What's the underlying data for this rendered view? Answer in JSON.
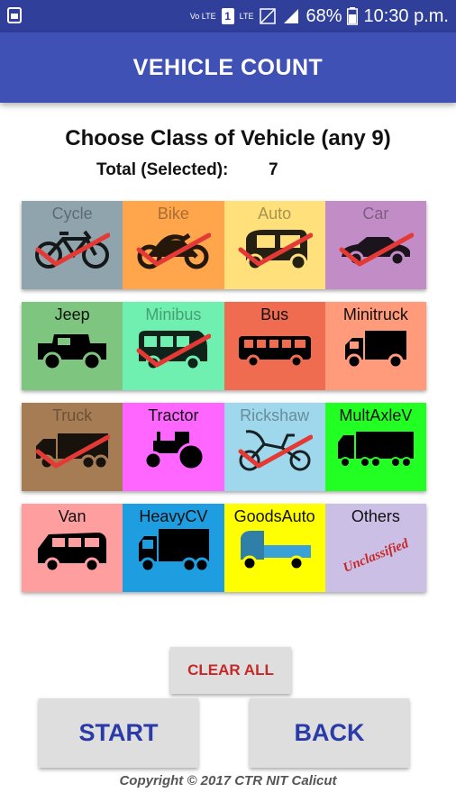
{
  "status_bar": {
    "volte": "Vo LTE",
    "sim": "1",
    "lte": "LTE",
    "battery": "68%",
    "time": "10:30 p.m."
  },
  "app_bar": {
    "title": "VEHICLE COUNT"
  },
  "heading": "Choose Class of Vehicle (any 9)",
  "total": {
    "label": "Total (Selected):",
    "value": "7"
  },
  "tiles": [
    {
      "label": "Cycle",
      "color": "#90a4ae",
      "selected": true,
      "icon": "bicycle-icon"
    },
    {
      "label": "Bike",
      "color": "#ffa64d",
      "selected": true,
      "icon": "motorbike-icon"
    },
    {
      "label": "Auto",
      "color": "#ffe07a",
      "selected": true,
      "icon": "autorickshaw-icon"
    },
    {
      "label": "Car",
      "color": "#c28dc7",
      "selected": true,
      "icon": "car-icon"
    },
    {
      "label": "Jeep",
      "color": "#7ec57f",
      "selected": false,
      "icon": "jeep-icon"
    },
    {
      "label": "Minibus",
      "color": "#6ff0b0",
      "selected": true,
      "icon": "minibus-icon"
    },
    {
      "label": "Bus",
      "color": "#ef6c50",
      "selected": false,
      "icon": "bus-icon"
    },
    {
      "label": "Minitruck",
      "color": "#ff9b7a",
      "selected": false,
      "icon": "minitruck-icon"
    },
    {
      "label": "Truck",
      "color": "#a67c55",
      "selected": true,
      "icon": "truck-icon"
    },
    {
      "label": "Tractor",
      "color": "#ff66ff",
      "selected": false,
      "icon": "tractor-icon"
    },
    {
      "label": "Rickshaw",
      "color": "#9fd8ec",
      "selected": true,
      "icon": "cycle-rickshaw-icon"
    },
    {
      "label": "MultAxleV",
      "color": "#22ff22",
      "selected": false,
      "icon": "multi-axle-truck-icon"
    },
    {
      "label": "Van",
      "color": "#ff9e9e",
      "selected": false,
      "icon": "van-icon"
    },
    {
      "label": "HeavyCV",
      "color": "#1e9de0",
      "selected": false,
      "icon": "heavy-truck-icon"
    },
    {
      "label": "GoodsAuto",
      "color": "#ffff00",
      "selected": false,
      "icon": "goods-auto-icon"
    },
    {
      "label": "Others",
      "color": "#cbbfe6",
      "selected": false,
      "icon": "unclassified-stamp",
      "stamp": "Unclassified"
    }
  ],
  "buttons": {
    "clear_all": "CLEAR ALL",
    "start": "START",
    "back": "BACK"
  },
  "copyright": "Copyright © 2017 CTR NIT Calicut"
}
